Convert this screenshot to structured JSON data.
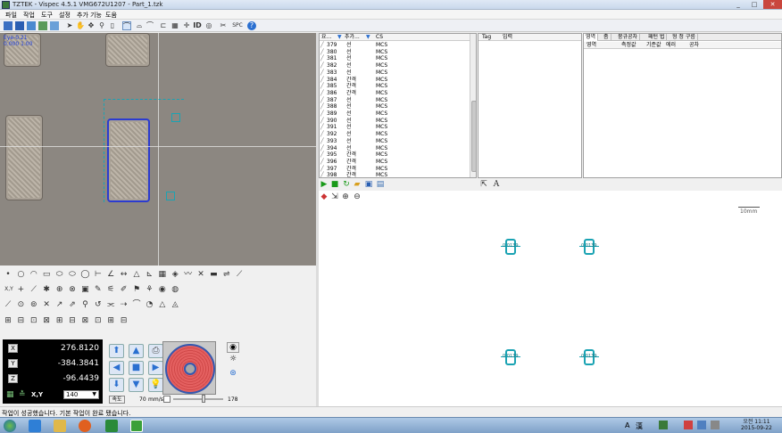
{
  "window": {
    "title": "TZTEK - Vispec 4.5.1 VMG672U1207 - Part_1.tzk",
    "minimize": "_",
    "maximize": "□",
    "close": "✕"
  },
  "menu": [
    "파일",
    "작업",
    "도구",
    "설정",
    "추가 기능",
    "도움"
  ],
  "toolbar": {
    "id_label": "ID",
    "spc_label": "SPC"
  },
  "camera": {
    "overlay_line1": "Eye-0.21",
    "overlay_line2": "0.000 1.00"
  },
  "feature_list": {
    "headers": [
      "요...",
      "추가...",
      "CS"
    ],
    "rows": [
      {
        "n": "379",
        "type": "선",
        "cs": "MCS"
      },
      {
        "n": "380",
        "type": "선",
        "cs": "MCS"
      },
      {
        "n": "381",
        "type": "선",
        "cs": "MCS"
      },
      {
        "n": "382",
        "type": "선",
        "cs": "MCS"
      },
      {
        "n": "383",
        "type": "선",
        "cs": "MCS"
      },
      {
        "n": "384",
        "type": "간격",
        "cs": "MCS"
      },
      {
        "n": "385",
        "type": "간격",
        "cs": "MCS"
      },
      {
        "n": "386",
        "type": "간격",
        "cs": "MCS"
      },
      {
        "n": "387",
        "type": "선",
        "cs": "MCS"
      },
      {
        "n": "388",
        "type": "선",
        "cs": "MCS"
      },
      {
        "n": "389",
        "type": "선",
        "cs": "MCS"
      },
      {
        "n": "390",
        "type": "선",
        "cs": "MCS"
      },
      {
        "n": "391",
        "type": "선",
        "cs": "MCS"
      },
      {
        "n": "392",
        "type": "선",
        "cs": "MCS"
      },
      {
        "n": "393",
        "type": "선",
        "cs": "MCS"
      },
      {
        "n": "394",
        "type": "선",
        "cs": "MCS"
      },
      {
        "n": "395",
        "type": "간격",
        "cs": "MCS"
      },
      {
        "n": "396",
        "type": "간격",
        "cs": "MCS"
      },
      {
        "n": "397",
        "type": "간격",
        "cs": "MCS"
      },
      {
        "n": "398",
        "type": "간격",
        "cs": "MCS"
      }
    ]
  },
  "tag_panel": {
    "headers": [
      "Tag",
      "입력"
    ]
  },
  "result_panel": {
    "tabs": [
      "영역",
      "좀",
      "붕규공차",
      "패턴 법",
      "형 정 구름"
    ],
    "columns": [
      "영역",
      "측정값",
      "기준값",
      "에러",
      "공차"
    ]
  },
  "graphic_view": {
    "scale_label": "10mm",
    "features": [
      {
        "label": "0.0139"
      },
      {
        "label": "0.0139"
      },
      {
        "label": "0.0139"
      },
      {
        "label": "0.0139"
      }
    ]
  },
  "dro": {
    "x_label": "X",
    "y_label": "Y",
    "z_label": "Z",
    "x_value": "276.8120",
    "y_value": "-384.3841",
    "z_value": "-96.4439",
    "xy_label": "X,Y",
    "dropdown_value": "140"
  },
  "jog": {
    "speed_button": "속도",
    "speed_value": "70",
    "speed_unit": "mm/s",
    "slider_value": "178"
  },
  "status": {
    "message": "작업이 성공했습니다.  기본 작업이 완료 됐습니다."
  },
  "taskbar": {
    "lang": "A",
    "lang2": "漢",
    "time": "오전 11:11",
    "date": "2015-09-22"
  },
  "colors": {
    "accent": "#2a6fd0",
    "feature": "#1aa3b3",
    "laser_ring": "#e05050",
    "background_camera": "#8c8781"
  }
}
